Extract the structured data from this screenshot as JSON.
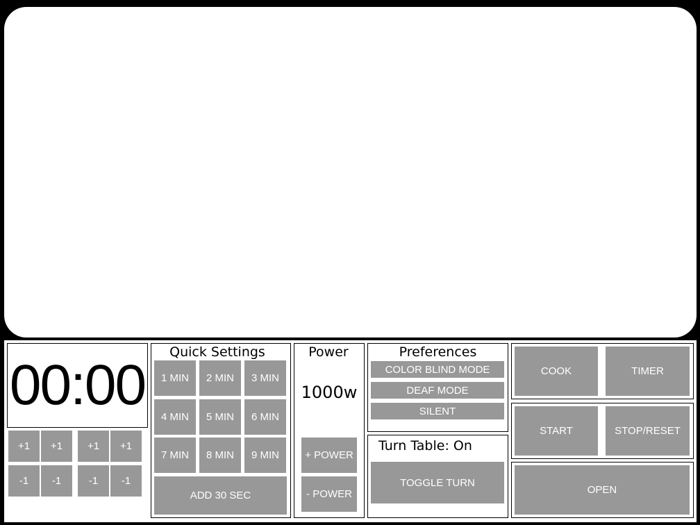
{
  "timer": {
    "display": "00:00"
  },
  "time_adjust": {
    "plus": [
      "+1",
      "+1",
      "+1",
      "+1"
    ],
    "minus": [
      "-1",
      "-1",
      "-1",
      "-1"
    ]
  },
  "quick_settings": {
    "title": "Quick Settings",
    "buttons": [
      "1 MIN",
      "2 MIN",
      "3 MIN",
      "4 MIN",
      "5 MIN",
      "6 MIN",
      "7 MIN",
      "8 MIN",
      "9 MIN"
    ],
    "add_30": "ADD 30 SEC"
  },
  "power": {
    "title": "Power",
    "value": "1000w",
    "plus": "+ POWER",
    "minus": "- POWER"
  },
  "preferences": {
    "title": "Preferences",
    "color_blind": "COLOR BLIND MODE",
    "deaf": "DEAF MODE",
    "silent": "SILENT"
  },
  "turntable": {
    "status": "Turn Table: On",
    "toggle": "TOGGLE TURN"
  },
  "controls": {
    "cook": "COOK",
    "timer": "TIMER",
    "start": "START",
    "stop_reset": "STOP/RESET",
    "open": "OPEN"
  }
}
